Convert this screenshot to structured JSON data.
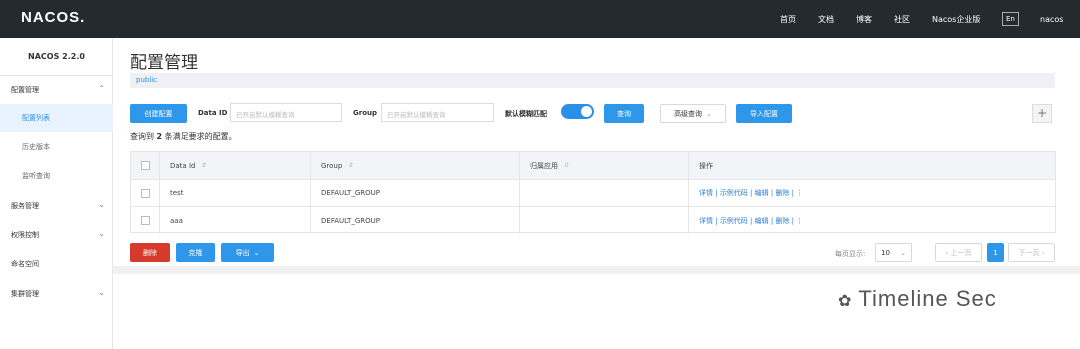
{
  "header": {
    "logo": "NACOS.",
    "nav": [
      "首页",
      "文档",
      "博客",
      "社区",
      "Nacos企业版"
    ],
    "lang": "En",
    "user": "nacos"
  },
  "sidebar": {
    "version": "NACOS 2.2.0",
    "items": [
      {
        "label": "配置管理"
      },
      {
        "label": "配置列表"
      },
      {
        "label": "历史版本"
      },
      {
        "label": "监听查询"
      },
      {
        "label": "服务管理"
      },
      {
        "label": "权限控制"
      },
      {
        "label": "命名空间"
      },
      {
        "label": "集群管理"
      }
    ]
  },
  "main": {
    "title": "配置管理",
    "namespace": "public",
    "create_button": "创建配置",
    "dataid_label": "Data ID",
    "dataid_placeholder": "已开启默认模糊查询",
    "group_label": "Group",
    "group_placeholder": "已开启默认模糊查询",
    "fuzzy_label": "默认模糊匹配",
    "query_button": "查询",
    "advanced_button": "高级查询",
    "import_button": "导入配置",
    "plus": "+",
    "summary_prefix": "查询到",
    "summary_count": "2",
    "summary_suffix": "条满足要求的配置。"
  },
  "table": {
    "headers": [
      "Data Id",
      "Group",
      "归属应用",
      "操作"
    ],
    "rows": [
      {
        "dataid": "test",
        "group": "DEFAULT_GROUP",
        "app": ""
      },
      {
        "dataid": "aaa",
        "group": "DEFAULT_GROUP",
        "app": ""
      }
    ],
    "ops": [
      "详情",
      "示例代码",
      "编辑",
      "删除"
    ]
  },
  "footer": {
    "delete_button": "删除",
    "clone_button": "克隆",
    "export_button": "导出",
    "page_size_label": "每页显示:",
    "page_size": "10",
    "prev": "上一页",
    "page": "1",
    "next": "下一页"
  },
  "watermark": "Timeline Sec",
  "colors": {
    "primary": "#2f97ea",
    "danger": "#d63a2c",
    "header_bg": "#252a2f"
  }
}
